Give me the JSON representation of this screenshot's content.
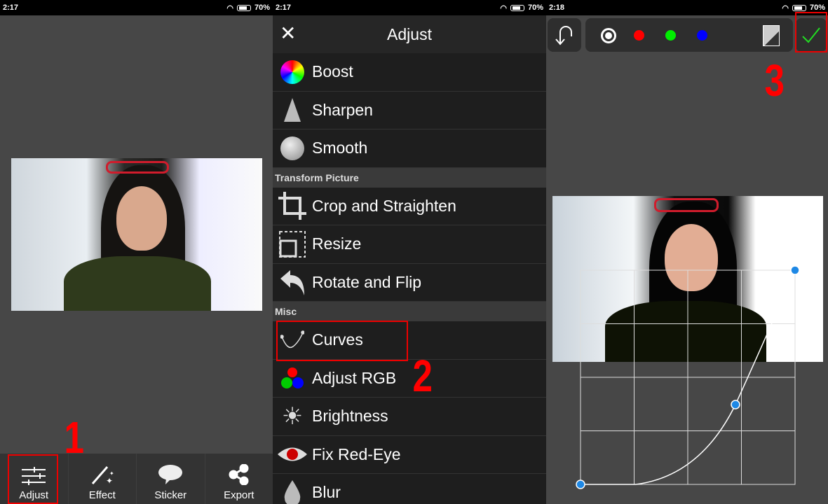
{
  "panels": [
    {
      "status": {
        "time": "2:17",
        "battery": "70%"
      }
    },
    {
      "status": {
        "time": "2:17",
        "battery": "70%"
      }
    },
    {
      "status": {
        "time": "2:18",
        "battery": "70%"
      }
    }
  ],
  "editor": {
    "toolbar": [
      {
        "label": "Adjust",
        "icon": "sliders-icon"
      },
      {
        "label": "Effect",
        "icon": "magic-wand-icon"
      },
      {
        "label": "Sticker",
        "icon": "speech-bubble-icon"
      },
      {
        "label": "Export",
        "icon": "share-icon"
      }
    ]
  },
  "adjust": {
    "title": "Adjust",
    "items_top": [
      "Boost",
      "Sharpen",
      "Smooth"
    ],
    "section_transform": "Transform Picture",
    "items_transform": [
      "Crop and Straighten",
      "Resize",
      "Rotate and Flip"
    ],
    "section_misc": "Misc",
    "items_misc": [
      "Curves",
      "Adjust RGB",
      "Brightness",
      "Fix Red-Eye",
      "Blur"
    ]
  },
  "curves": {
    "channels": [
      "rgb",
      "red",
      "green",
      "blue"
    ],
    "colors": {
      "red": "#ff0000",
      "green": "#00e000",
      "blue": "#0000ff",
      "point": "#1e88e5",
      "check": "#22dd22"
    },
    "points": [
      [
        0,
        0
      ],
      [
        0.72,
        0.37
      ],
      [
        1,
        1
      ]
    ]
  },
  "annotations": [
    "1",
    "2",
    "3"
  ]
}
